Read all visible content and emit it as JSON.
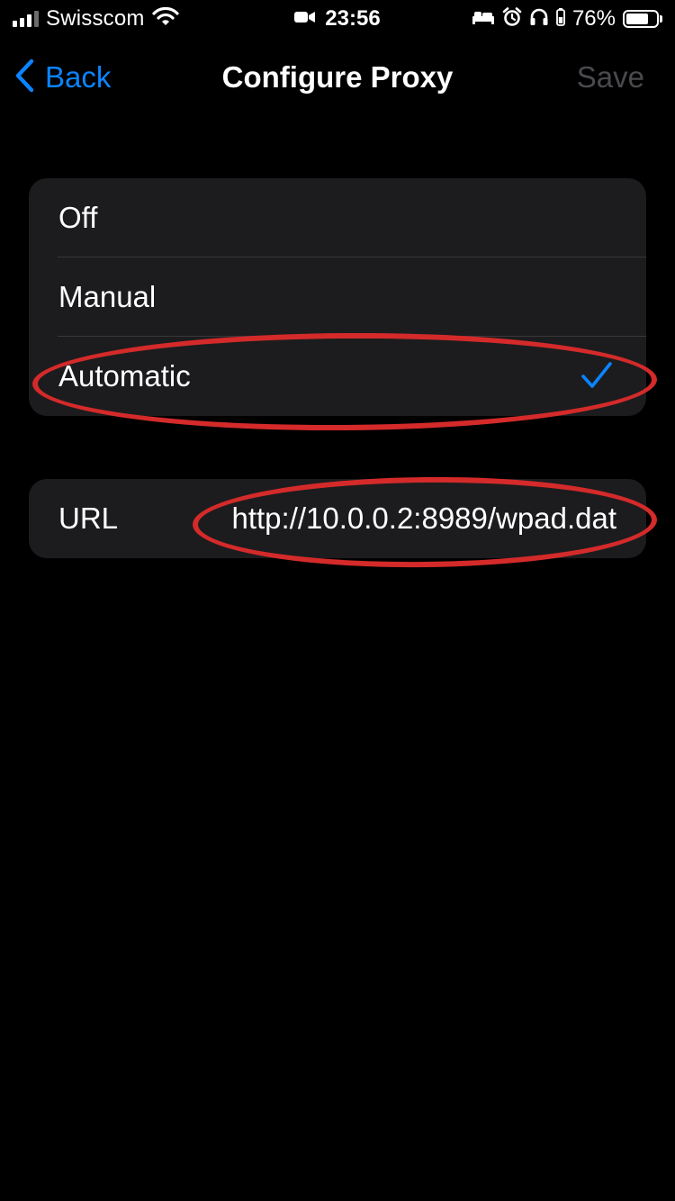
{
  "status_bar": {
    "carrier": "Swisscom",
    "time": "23:56",
    "battery_percent": "76%",
    "battery_level": 0.76,
    "icons": [
      "signal-icon",
      "wifi-icon",
      "video-camera-icon",
      "bed-icon",
      "alarm-icon",
      "headphones-icon",
      "battery-icon"
    ]
  },
  "nav": {
    "back_label": "Back",
    "title": "Configure Proxy",
    "save_label": "Save"
  },
  "proxy_modes": [
    {
      "label": "Off",
      "selected": false
    },
    {
      "label": "Manual",
      "selected": false
    },
    {
      "label": "Automatic",
      "selected": true
    }
  ],
  "url_field": {
    "label": "URL",
    "value": "http://10.0.0.2:8989/wpad.dat"
  },
  "colors": {
    "accent": "#0a84ff",
    "background": "#000000",
    "group_background": "#1c1c1e",
    "disabled_text": "#4a4a4e",
    "annotation": "#d42a2a"
  }
}
